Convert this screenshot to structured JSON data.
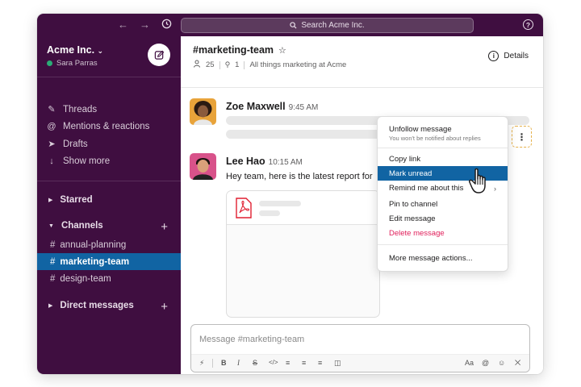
{
  "search": {
    "placeholder": "Search Acme Inc."
  },
  "workspace": {
    "name": "Acme Inc.",
    "user": "Sara Parras"
  },
  "sidebar": {
    "nav": [
      {
        "label": "Threads",
        "icon": "threads-icon"
      },
      {
        "label": "Mentions & reactions",
        "icon": "at-icon"
      },
      {
        "label": "Drafts",
        "icon": "drafts-icon"
      },
      {
        "label": "Show more",
        "icon": "arrow-down-icon"
      }
    ],
    "starred": "Starred",
    "channels_label": "Channels",
    "channels": [
      "annual-planning",
      "marketing-team",
      "design-team"
    ],
    "active_channel": "marketing-team",
    "direct_messages": "Direct messages"
  },
  "channel": {
    "title": "#marketing-team",
    "members": "25",
    "pinned": "1",
    "topic": "All things marketing at Acme",
    "details": "Details"
  },
  "messages": [
    {
      "name": "Zoe Maxwell",
      "time": "9:45 AM"
    },
    {
      "name": "Lee Hao",
      "time": "10:15 AM",
      "text": "Hey team, here is the latest report for"
    }
  ],
  "composer": {
    "placeholder": "Message #marketing-team"
  },
  "context_menu": {
    "unfollow": "Unfollow message",
    "unfollow_sub": "You won't be notified about replies",
    "items": [
      "Copy link",
      "Mark unread",
      "Remind me about this",
      "Pin to channel",
      "Edit message",
      "Delete message"
    ],
    "more": "More message actions...",
    "highlighted": "Mark unread"
  },
  "colors": {
    "sidebar": "#3f0e40",
    "active": "#1164a3",
    "danger": "#e01e5a",
    "online": "#2bac76"
  }
}
